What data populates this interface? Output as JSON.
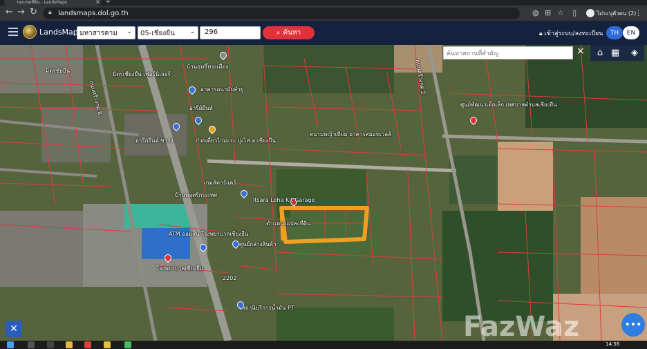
{
  "browser": {
    "tab_title": "ขอบเขตที่ดิน - LandsMaps",
    "url": "landsmaps.dol.go.th",
    "profile_label": "ไม่ระบุตัวตน (2)"
  },
  "header": {
    "brand": "LandsMaps",
    "province": "มหาสารคาม",
    "district": "05-เชียงยืน",
    "parcel_number": "296",
    "search_label": "ค้นหา",
    "login_label": "เข้าสู่ระบบ/ลงทะเบียน",
    "lang_th": "TH",
    "lang_en": "EN"
  },
  "map": {
    "place_search_placeholder": "ค้นหาสถานที่สำคัญ",
    "labels": {
      "l1": "มิตรชัยยืน",
      "l2": "มิตรเชียงยืน เฟอร์นิเจอร์",
      "l3": "บ้านฤทธิ์ทรงเมือง",
      "l4": "อาคารอนามัยลำยู",
      "l5": "อารีย์ยืนห์",
      "l6": "ถนนศรีวงกต 8",
      "l7": "อารีย์ยืนห์ ซาร่ง",
      "l8": "ก๋วยเตี๋ยวไก่มะระ ยุ่งไฟ อ.เชียงยืน",
      "l9": "สนามหญ้าเทียม อาคารสมอทเวลล์",
      "l10": "ถนนศรีวงกต 2",
      "l11": "ศูนย์พัฒนาเด็กเล็ก เทศบาลตำบลเชียงยืน",
      "l12": "เกมส์คาร์แคร์",
      "l13": "บ้านพลุศรีกระเทศ",
      "l14": "Itsara Leha Kit Garage",
      "l15": "ตำแหน่งแปลงที่ดิน",
      "l16": "ATM ออมสิน โรงพยาบาลเชียงยืน",
      "l17": "ศูนย์กลางสินค้า",
      "l18": "โรงพยาบาลเชียงยืน",
      "l19": "สถานีบริการน้ำมัน PT",
      "l20": "2202"
    },
    "watermark": "FazWaz"
  },
  "taskbar": {
    "clock": "14:56"
  },
  "colors": {
    "header_bg": "#14223d",
    "search_button": "#e2313b",
    "lang_active": "#2f6bd6",
    "parcel_outline": "#f0a020",
    "parcel_lines": "#e23a3a"
  }
}
